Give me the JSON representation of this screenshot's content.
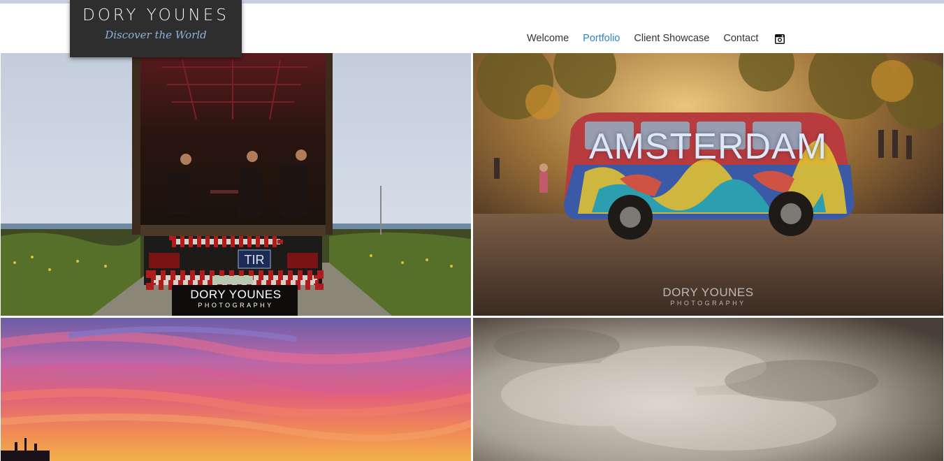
{
  "header": {
    "logo": {
      "name": "DORY YOUNES",
      "tagline": "Discover the World"
    },
    "nav": [
      {
        "label": "Welcome",
        "active": false
      },
      {
        "label": "Portfolio",
        "active": true
      },
      {
        "label": "Client Showcase",
        "active": false
      },
      {
        "label": "Contact",
        "active": false
      }
    ],
    "social_icon": "instagram-icon"
  },
  "gallery": {
    "tiles": [
      {
        "title": "",
        "watermark_name": "DORY YOUNES",
        "watermark_sub": "PHOTOGRAPHY",
        "plate_text": "TIR"
      },
      {
        "title": "AMSTERDAM",
        "watermark_name": "DORY YOUNES",
        "watermark_sub": "PHOTOGRAPHY"
      },
      {
        "title": ""
      },
      {
        "title": ""
      }
    ]
  },
  "colors": {
    "accent": "#2f86c9",
    "logo_bg": "#2e2e2e",
    "tagline": "#8fb2e0",
    "nav_text": "#333333"
  }
}
